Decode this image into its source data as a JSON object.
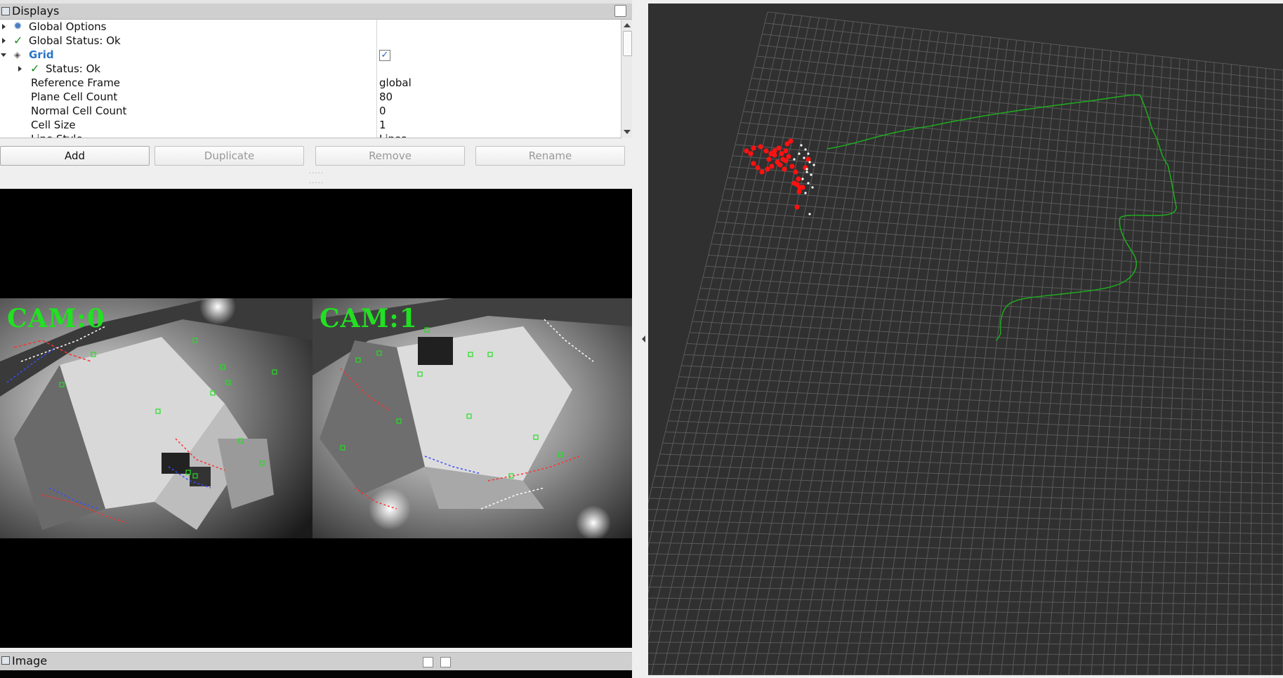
{
  "displays_panel": {
    "title": "Displays",
    "rows": [
      {
        "label": "Global Options",
        "value": ""
      },
      {
        "label": "Global Status: Ok",
        "value": ""
      },
      {
        "label": "Grid",
        "value": "✓"
      },
      {
        "label": "Status: Ok",
        "value": ""
      },
      {
        "label": "Reference Frame",
        "value": "global"
      },
      {
        "label": "Plane Cell Count",
        "value": "80"
      },
      {
        "label": "Normal Cell Count",
        "value": "0"
      },
      {
        "label": "Cell Size",
        "value": "1"
      },
      {
        "label": "Line Style",
        "value": "Lines"
      }
    ],
    "buttons": {
      "add": "Add",
      "duplicate": "Duplicate",
      "remove": "Remove",
      "rename": "Rename"
    }
  },
  "image_panel": {
    "title": "Image",
    "cameras": [
      {
        "label": "CAM:0"
      },
      {
        "label": "CAM:1"
      }
    ]
  },
  "colors": {
    "trajectory": "#1fa81f",
    "landmarks": "#ff1111",
    "current_points": "#ffffff",
    "grid_lines": "#5a5a5a",
    "background": "#303030",
    "cam_label": "#22e022"
  }
}
